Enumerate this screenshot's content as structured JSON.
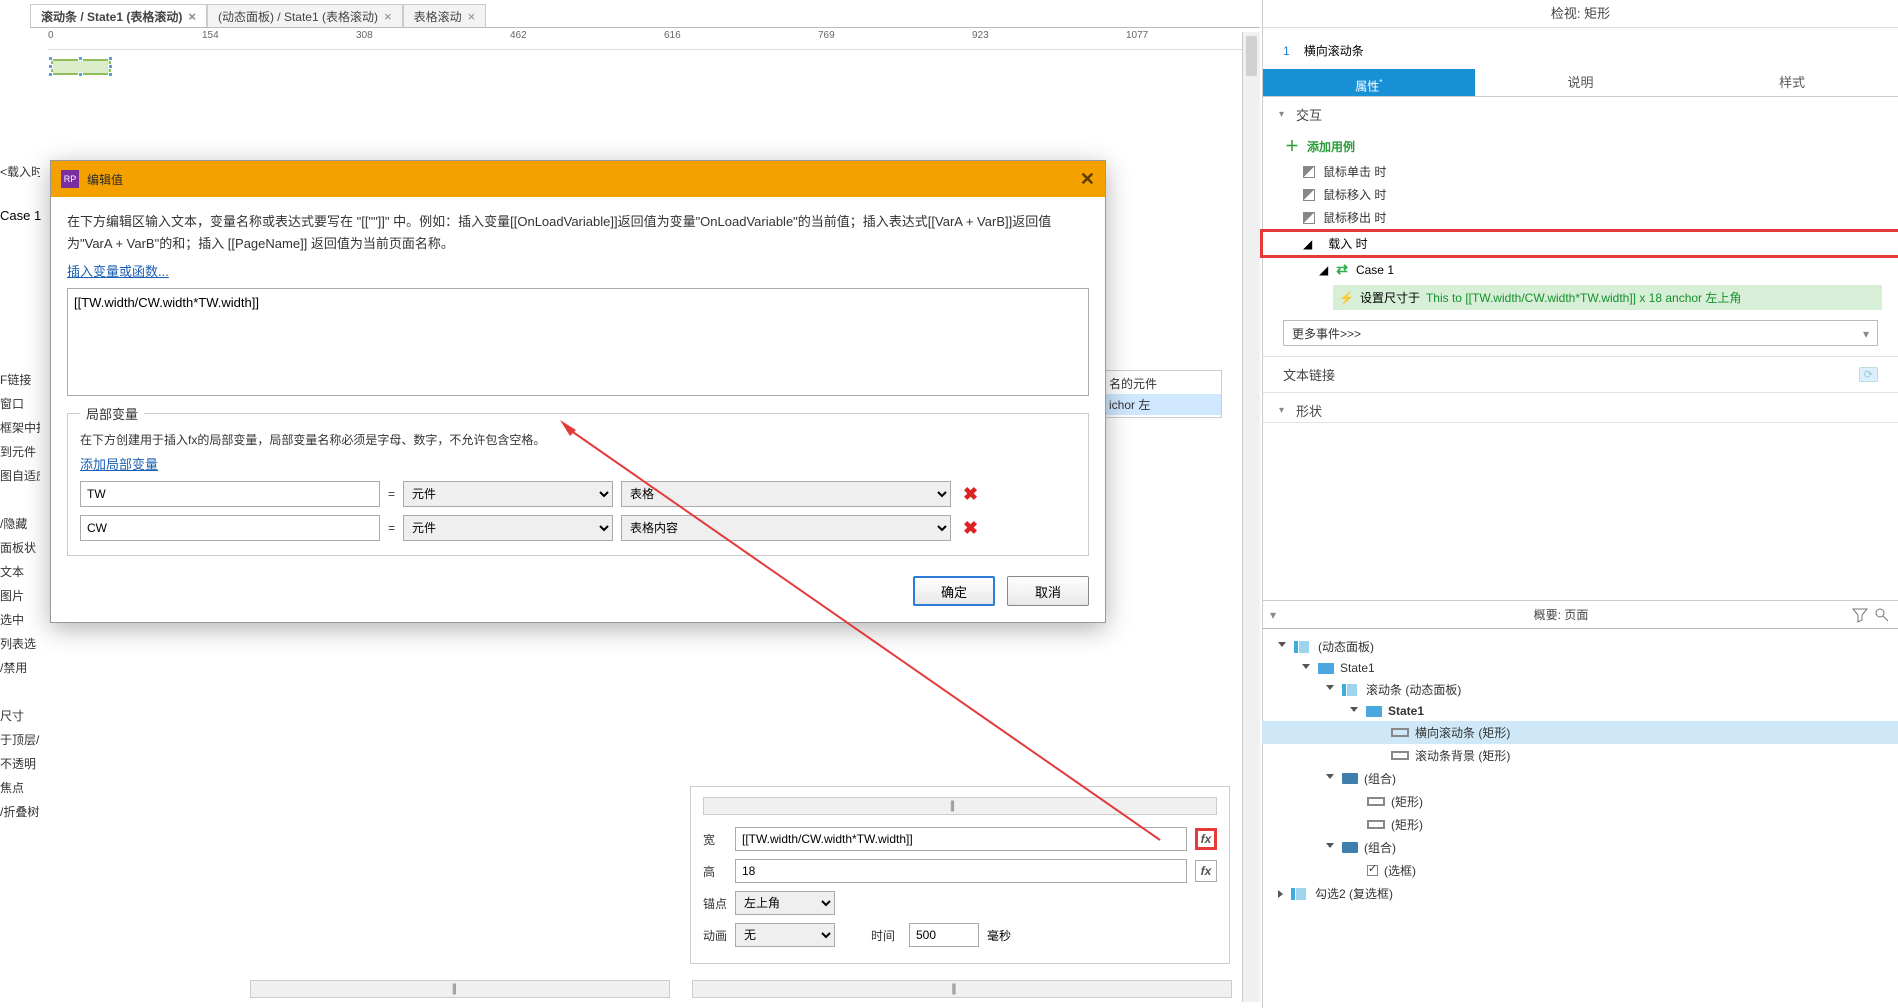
{
  "tabs": [
    {
      "label": "滚动条 / State1 (表格滚动)",
      "x": "×"
    },
    {
      "label": "(动态面板) / State1 (表格滚动)",
      "x": "×"
    },
    {
      "label": "表格滚动",
      "x": "×"
    }
  ],
  "ruler": {
    "t0": "0",
    "t1": "154",
    "t2": "308",
    "t3": "462",
    "t4": "616",
    "t5": "769",
    "t6": "923",
    "t7": "1077"
  },
  "left_edge": {
    "breadcrumb": "<载入时>",
    "case1": "Case 1",
    "items": [
      "F链接",
      "窗口",
      "框架中打",
      "到元件",
      "图自适应",
      "",
      "/隐藏",
      "面板状",
      "文本",
      "图片",
      "选中",
      "列表选",
      "/禁用",
      "",
      "尺寸",
      "于顶层/底层",
      "不透明",
      "焦点",
      "/折叠树节点"
    ]
  },
  "case_fragment": {
    "header": "名的元件",
    "sel": "ichor 左"
  },
  "bottom_panel": {
    "width_label": "宽",
    "width_value": "[[TW.width/CW.width*TW.width]]",
    "height_label": "高",
    "height_value": "18",
    "anchor_label": "锚点",
    "anchor_value": "左上角",
    "anim_label": "动画",
    "anim_value": "无",
    "time_label": "时间",
    "time_value": "500",
    "time_unit": "毫秒",
    "fx": "fx"
  },
  "dialog": {
    "title": "编辑值",
    "hint": "在下方编辑区输入文本，变量名称或表达式要写在 \"[[\"\"]]\" 中。例如：插入变量[[OnLoadVariable]]返回值为变量\"OnLoadVariable\"的当前值；插入表达式[[VarA + VarB]]返回值为\"VarA + VarB\"的和；插入 [[PageName]] 返回值为当前页面名称。",
    "insert_link": "插入变量或函数...",
    "expression": "[[TW.width/CW.width*TW.width]]",
    "local_title": "局部变量",
    "local_hint": "在下方创建用于插入fx的局部变量，局部变量名称必须是字母、数字，不允许包含空格。",
    "add_local_link": "添加局部变量",
    "rows": [
      {
        "name": "TW",
        "eq": "=",
        "type": "元件",
        "target": "表格",
        "del": "✖"
      },
      {
        "name": "CW",
        "eq": "=",
        "type": "元件",
        "target": "表格内容",
        "del": "✖"
      }
    ],
    "ok": "确定",
    "cancel": "取消"
  },
  "props": {
    "header": "检视: 矩形",
    "id": "1",
    "name": "横向滚动条",
    "tabs": {
      "prop": "属性",
      "dirty": "*",
      "notes": "说明",
      "style": "样式"
    },
    "sec_interaction": "交互",
    "add_usecase": "添加用例",
    "evt_click": "鼠标单击 时",
    "evt_enter": "鼠标移入 时",
    "evt_leave": "鼠标移出 时",
    "evt_load": "载入 时",
    "case1": "Case 1",
    "action_prefix": "设置尺寸于 ",
    "action_green": "This to [[TW.width/CW.width*TW.width]] x 18 anchor 左上角",
    "more": "更多事件>>>",
    "textlink": "文本链接",
    "shape": "形状"
  },
  "outline": {
    "header": "概要: 页面",
    "nodes": [
      {
        "d": 0,
        "tw": "o",
        "icon": "dp",
        "label": "(动态面板)"
      },
      {
        "d": 1,
        "tw": "o",
        "icon": "state",
        "label": "State1"
      },
      {
        "d": 2,
        "tw": "o",
        "icon": "dp",
        "label": "滚动条 (动态面板)"
      },
      {
        "d": 3,
        "tw": "o",
        "icon": "state",
        "label": "State1",
        "bold": true
      },
      {
        "d": 4,
        "tw": "",
        "icon": "rect",
        "label": "横向滚动条 (矩形)",
        "selected": true
      },
      {
        "d": 4,
        "tw": "",
        "icon": "rect",
        "label": "滚动条背景 (矩形)"
      },
      {
        "d": 2,
        "tw": "o",
        "icon": "fold",
        "label": "(组合)"
      },
      {
        "d": 3,
        "tw": "",
        "icon": "rect",
        "label": "(矩形)"
      },
      {
        "d": 3,
        "tw": "",
        "icon": "rect",
        "label": "(矩形)"
      },
      {
        "d": 2,
        "tw": "o",
        "icon": "fold",
        "label": "(组合)"
      },
      {
        "d": 3,
        "tw": "",
        "icon": "ck",
        "label": "(选框)"
      },
      {
        "d": 0,
        "tw": "c",
        "icon": "dp",
        "label": "勾选2 (复选框)"
      }
    ]
  }
}
